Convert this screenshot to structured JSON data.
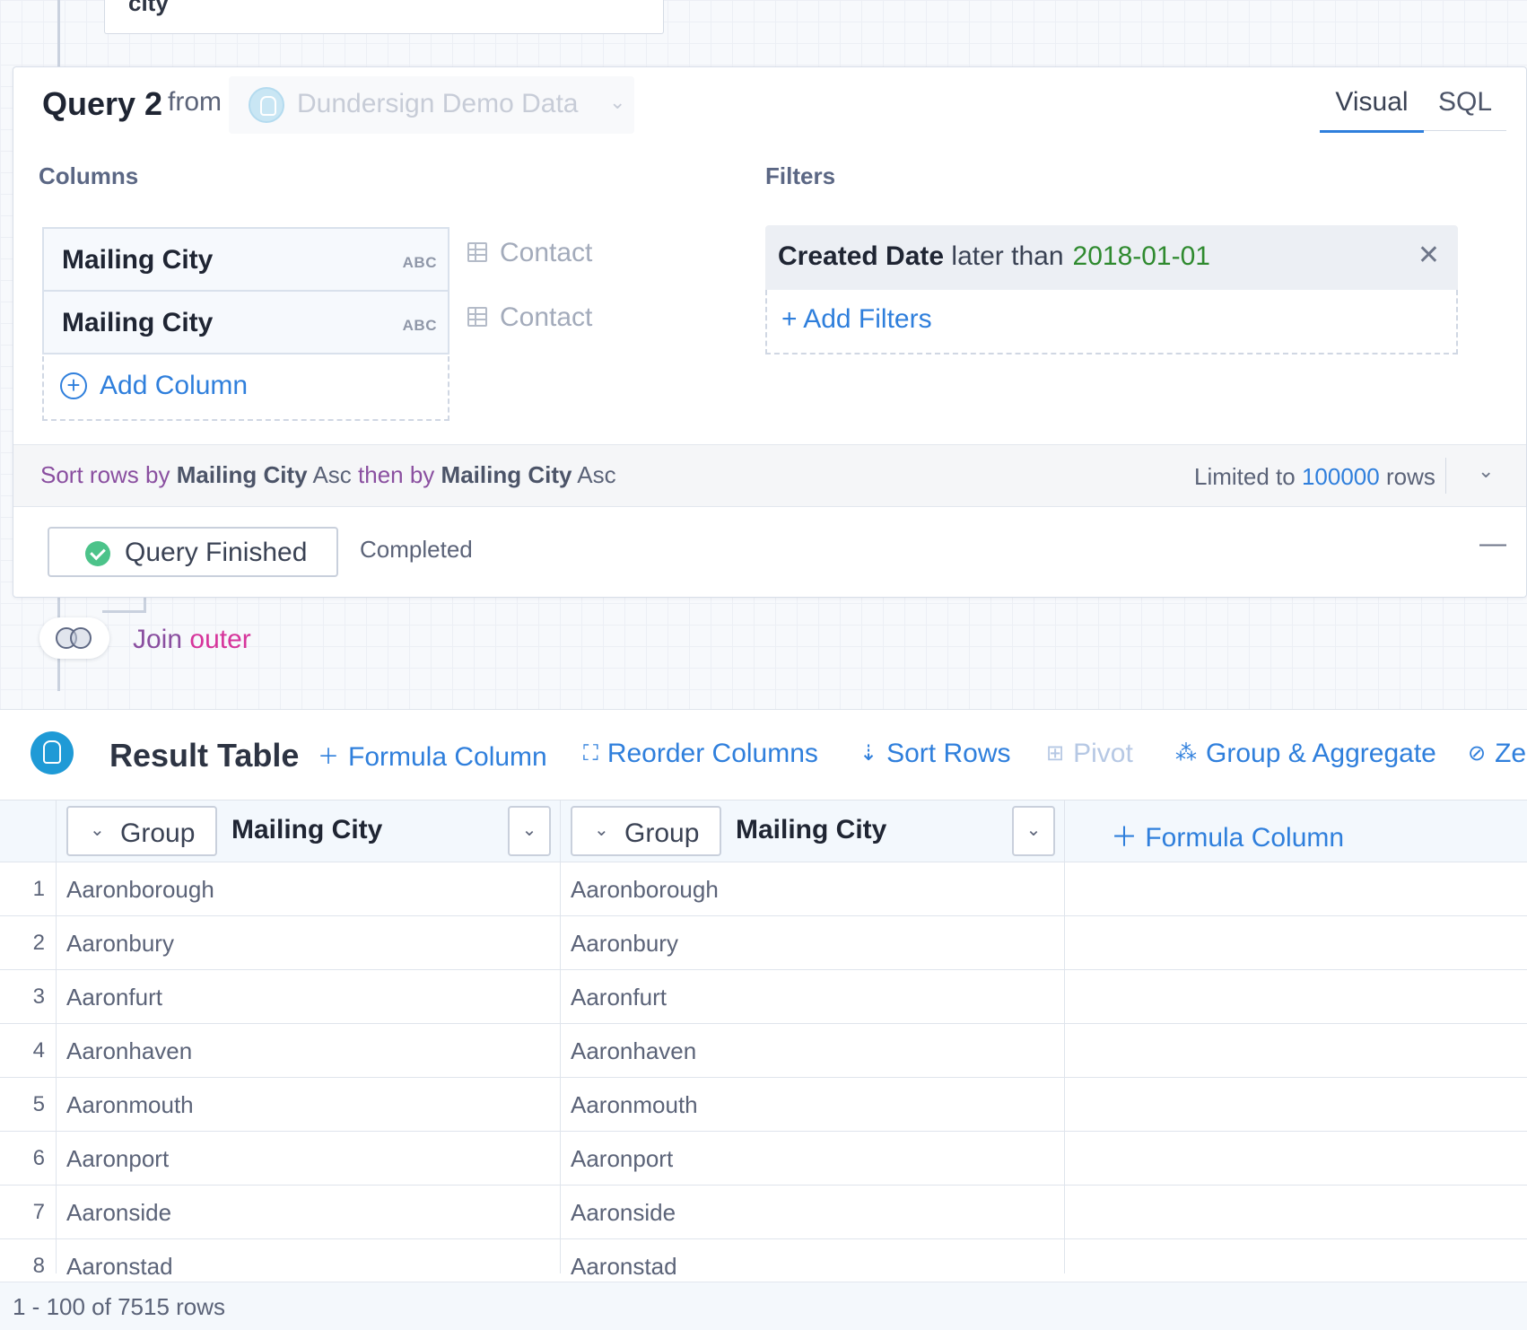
{
  "previous_block": {
    "label": "city"
  },
  "query": {
    "title": "Query 2",
    "from_label": "from",
    "datasource": "Dundersign Demo Data",
    "tabs": {
      "visual": "Visual",
      "sql": "SQL"
    },
    "columns_label": "Columns",
    "filters_label": "Filters",
    "columns": [
      {
        "name": "Mailing City",
        "type": "ABC",
        "source": "Contact"
      },
      {
        "name": "Mailing City",
        "type": "ABC",
        "source": "Contact"
      }
    ],
    "add_column_label": "Add Column",
    "filter": {
      "field": "Created Date",
      "operator": "later than",
      "value": "2018-01-01"
    },
    "add_filters_label": "+ Add Filters",
    "sort": {
      "prefix": "Sort rows by",
      "field1": "Mailing City",
      "dir1": "Asc",
      "then": "then by",
      "field2": "Mailing City",
      "dir2": "Asc"
    },
    "limit": {
      "prefix": "Limited to",
      "value": "100000",
      "suffix": "rows"
    },
    "status_label": "Query Finished",
    "status_text": "Completed",
    "collapse_glyph": "—"
  },
  "join": {
    "label": "Join",
    "type": "outer"
  },
  "result_table": {
    "title": "Result Table",
    "toolbar": {
      "formula_column": "Formula Column",
      "reorder_columns": "Reorder Columns",
      "sort_rows": "Sort Rows",
      "pivot": "Pivot",
      "group_aggregate": "Group & Aggregate",
      "zero_fill": "Ze"
    },
    "headers": [
      {
        "group_label": "Group",
        "name": "Mailing City"
      },
      {
        "group_label": "Group",
        "name": "Mailing City"
      }
    ],
    "header_formula": "Formula Column",
    "rows": [
      {
        "n": "1",
        "a": "Aaronborough",
        "b": "Aaronborough"
      },
      {
        "n": "2",
        "a": "Aaronbury",
        "b": "Aaronbury"
      },
      {
        "n": "3",
        "a": "Aaronfurt",
        "b": "Aaronfurt"
      },
      {
        "n": "4",
        "a": "Aaronhaven",
        "b": "Aaronhaven"
      },
      {
        "n": "5",
        "a": "Aaronmouth",
        "b": "Aaronmouth"
      },
      {
        "n": "6",
        "a": "Aaronport",
        "b": "Aaronport"
      },
      {
        "n": "7",
        "a": "Aaronside",
        "b": "Aaronside"
      },
      {
        "n": "8",
        "a": "Aaronstad",
        "b": "Aaronstad"
      }
    ],
    "footer": "1 - 100 of 7515 rows"
  },
  "colors": {
    "accent": "#2f7fdc",
    "join_type": "#d6359b",
    "filter_value": "#2f8a2f",
    "success": "#4cc38a"
  }
}
